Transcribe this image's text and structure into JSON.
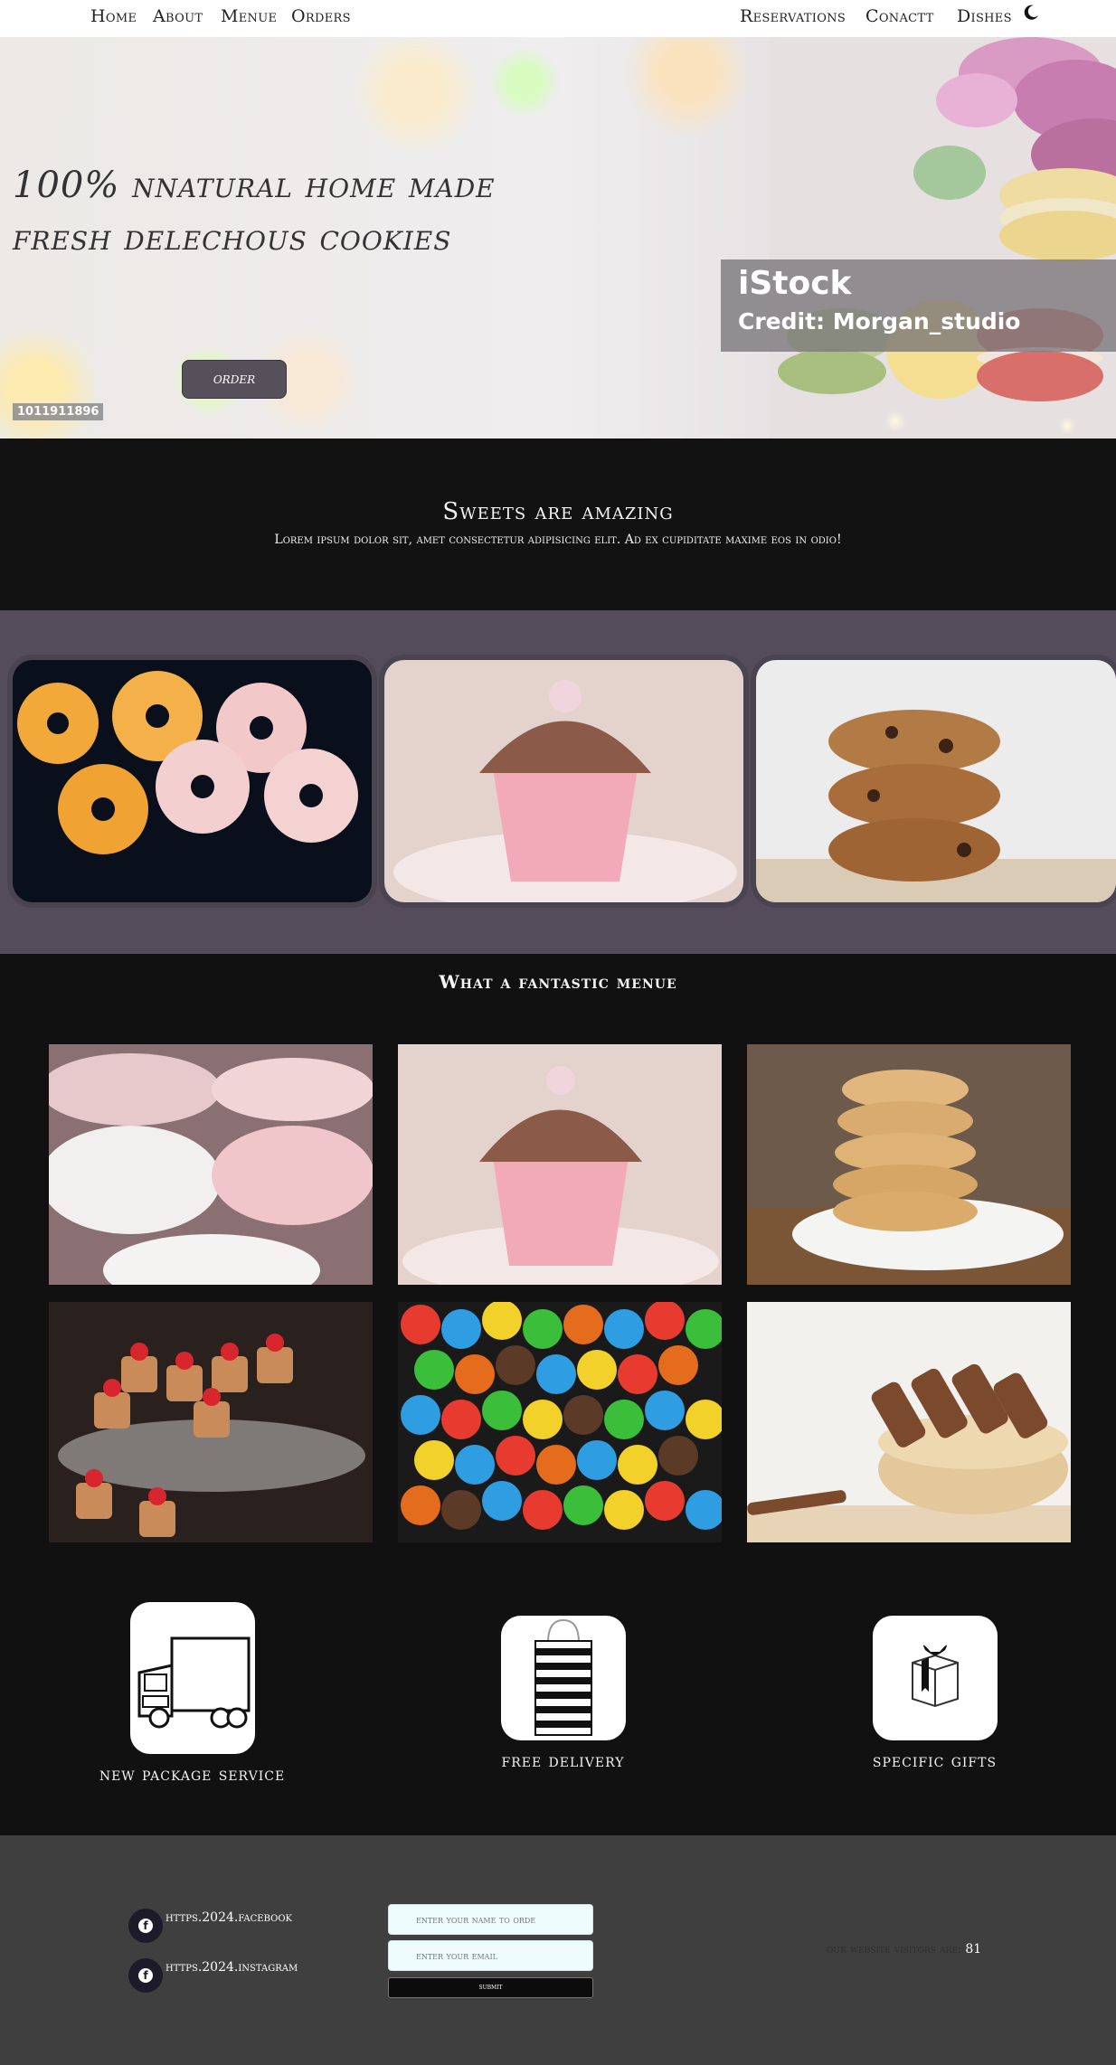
{
  "nav": {
    "left": [
      "Home",
      "About",
      "Menue",
      "Orders"
    ],
    "right": [
      "Reservations",
      "Conactt",
      "Dishes"
    ],
    "theme_icon": "moon-icon"
  },
  "hero": {
    "title": "100% nnatural home made fresh delechous cookies",
    "order_label": "order",
    "watermark_logo": "iStock",
    "watermark_credit": "Credit: Morgan_studio",
    "image_id": "1011911896"
  },
  "intro": {
    "heading": "Sweets are amazing",
    "text": "Lorem ipsum dolor sit, amet consectetur adipisicing elit. Ad ex cupiditate maxime eos in odio!"
  },
  "carousel": {
    "items": [
      "donuts-image",
      "cupcake-image",
      "cookies-stack-image"
    ]
  },
  "menu": {
    "title": "What a fantastic menue",
    "items": [
      "marshmallows-image",
      "cupcake-image",
      "peanut-butter-cookies-image",
      "strawberry-cupcakes-image",
      "candies-image",
      "wafer-rolls-image"
    ]
  },
  "features": [
    {
      "label": "new package service",
      "icon": "truck-icon"
    },
    {
      "label": "free delivery",
      "icon": "shopping-bag-icon"
    },
    {
      "label": "specific gifts",
      "icon": "gift-box-icon"
    }
  ],
  "footer": {
    "facebook": "https.2024.facebook",
    "instagram": "https.2024.instagram",
    "name_placeholder": "enter your name to orde",
    "email_placeholder": "enter your email",
    "submit_label": "submit",
    "visitors_label": "our website visitors are:",
    "visitors_count": "81"
  },
  "colors": {
    "nav_bg": "#ffffff",
    "dark_bg": "#121212",
    "carousel_bg": "#544c5a",
    "footer_bg": "#3f3f3f",
    "order_button": "#56505a"
  }
}
